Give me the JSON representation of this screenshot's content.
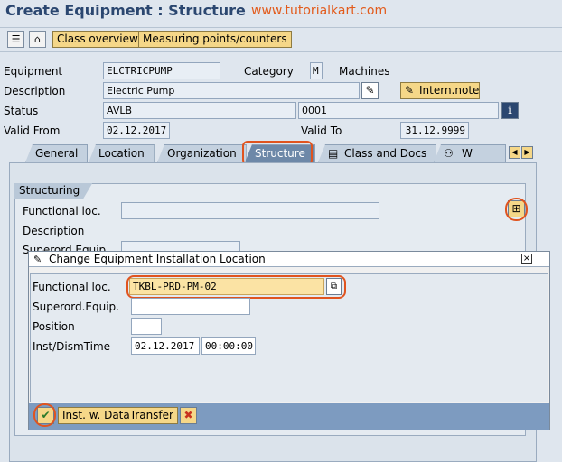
{
  "window": {
    "title": "Create Equipment : Structure",
    "watermark": "www.tutorialkart.com"
  },
  "toolbar": {
    "class_overview": "Class overview",
    "measuring_points": "Measuring points/counters"
  },
  "header": {
    "equipment_label": "Equipment",
    "equipment_value": "ELCTRICPUMP",
    "category_label": "Category",
    "category_value": "M",
    "category_text": "Machines",
    "description_label": "Description",
    "description_value": "Electric Pump",
    "intern_note": "Intern.note",
    "status_label": "Status",
    "status_value": "AVLB",
    "status_number": "0001",
    "valid_from_label": "Valid From",
    "valid_from_value": "02.12.2017",
    "valid_to_label": "Valid To",
    "valid_to_value": "31.12.9999"
  },
  "tabs": [
    {
      "label": "General"
    },
    {
      "label": "Location"
    },
    {
      "label": "Organization"
    },
    {
      "label": "Structure"
    },
    {
      "label": "Class and Docs"
    },
    {
      "label": "W"
    }
  ],
  "structuring": {
    "group_title": "Structuring",
    "functional_loc_label": "Functional loc.",
    "description_label": "Description",
    "superord_label": "Superord.Equip."
  },
  "dialog": {
    "title": "Change Equipment Installation Location",
    "functional_loc_label": "Functional loc.",
    "functional_loc_value": "TKBL-PRD-PM-02",
    "superord_label": "Superord.Equip.",
    "superord_value": "",
    "position_label": "Position",
    "position_value": "",
    "inst_label": "Inst/DismTime",
    "inst_date": "02.12.2017",
    "inst_time": "00:00:00",
    "transfer_button": "Inst. w. DataTransfer"
  },
  "colors": {
    "title": "#2b4770",
    "highlight_ring": "#e0541f",
    "button_yellow": "#f5d788",
    "input_yellow": "#fbe3a4"
  }
}
